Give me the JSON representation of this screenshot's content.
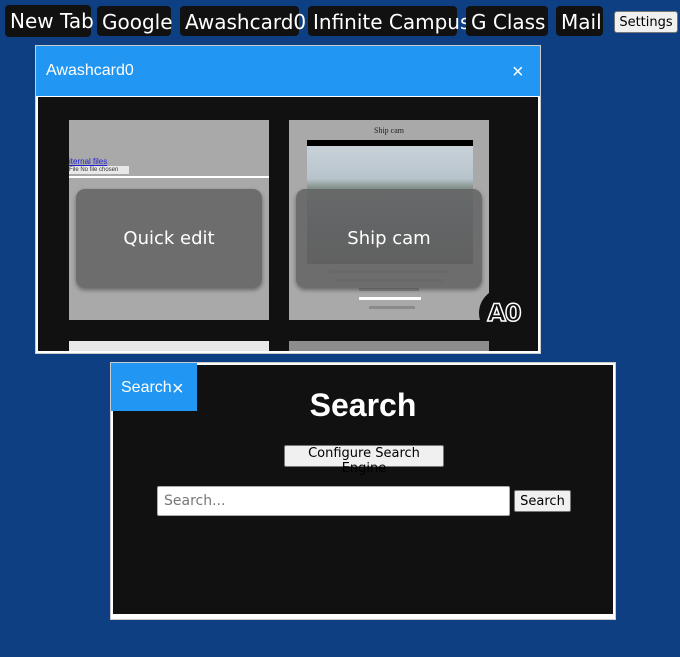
{
  "taskbar": {
    "tabs": [
      {
        "label": "New Tab"
      },
      {
        "label": "Google"
      },
      {
        "label": "Awashcard0"
      },
      {
        "label": "Infinite Campus"
      },
      {
        "label": "G Class"
      },
      {
        "label": "Mail"
      }
    ],
    "settings_label": "Settings"
  },
  "window_awashcard": {
    "title": "Awashcard0",
    "close_glyph": "×",
    "cards": [
      {
        "label": "Quick edit"
      },
      {
        "label": "Ship cam"
      }
    ],
    "thumb_quickedit": {
      "link_text": "iternal files",
      "file_text": "File   No file chosen"
    },
    "thumb_shipcam": {
      "title": "Ship cam"
    },
    "logo_text": "A0"
  },
  "window_search": {
    "tab_title": "Search",
    "close_glyph": "×",
    "heading": "Search",
    "configure_label": "Configure Search Engine",
    "search_placeholder": "Search...",
    "search_value": "",
    "search_button_label": "Search"
  },
  "colors": {
    "desktop": "#0e3f82",
    "accent": "#2196f3",
    "panel": "#111111"
  },
  "icons": {
    "close": "close-icon",
    "logo": "awashcard-logo"
  }
}
